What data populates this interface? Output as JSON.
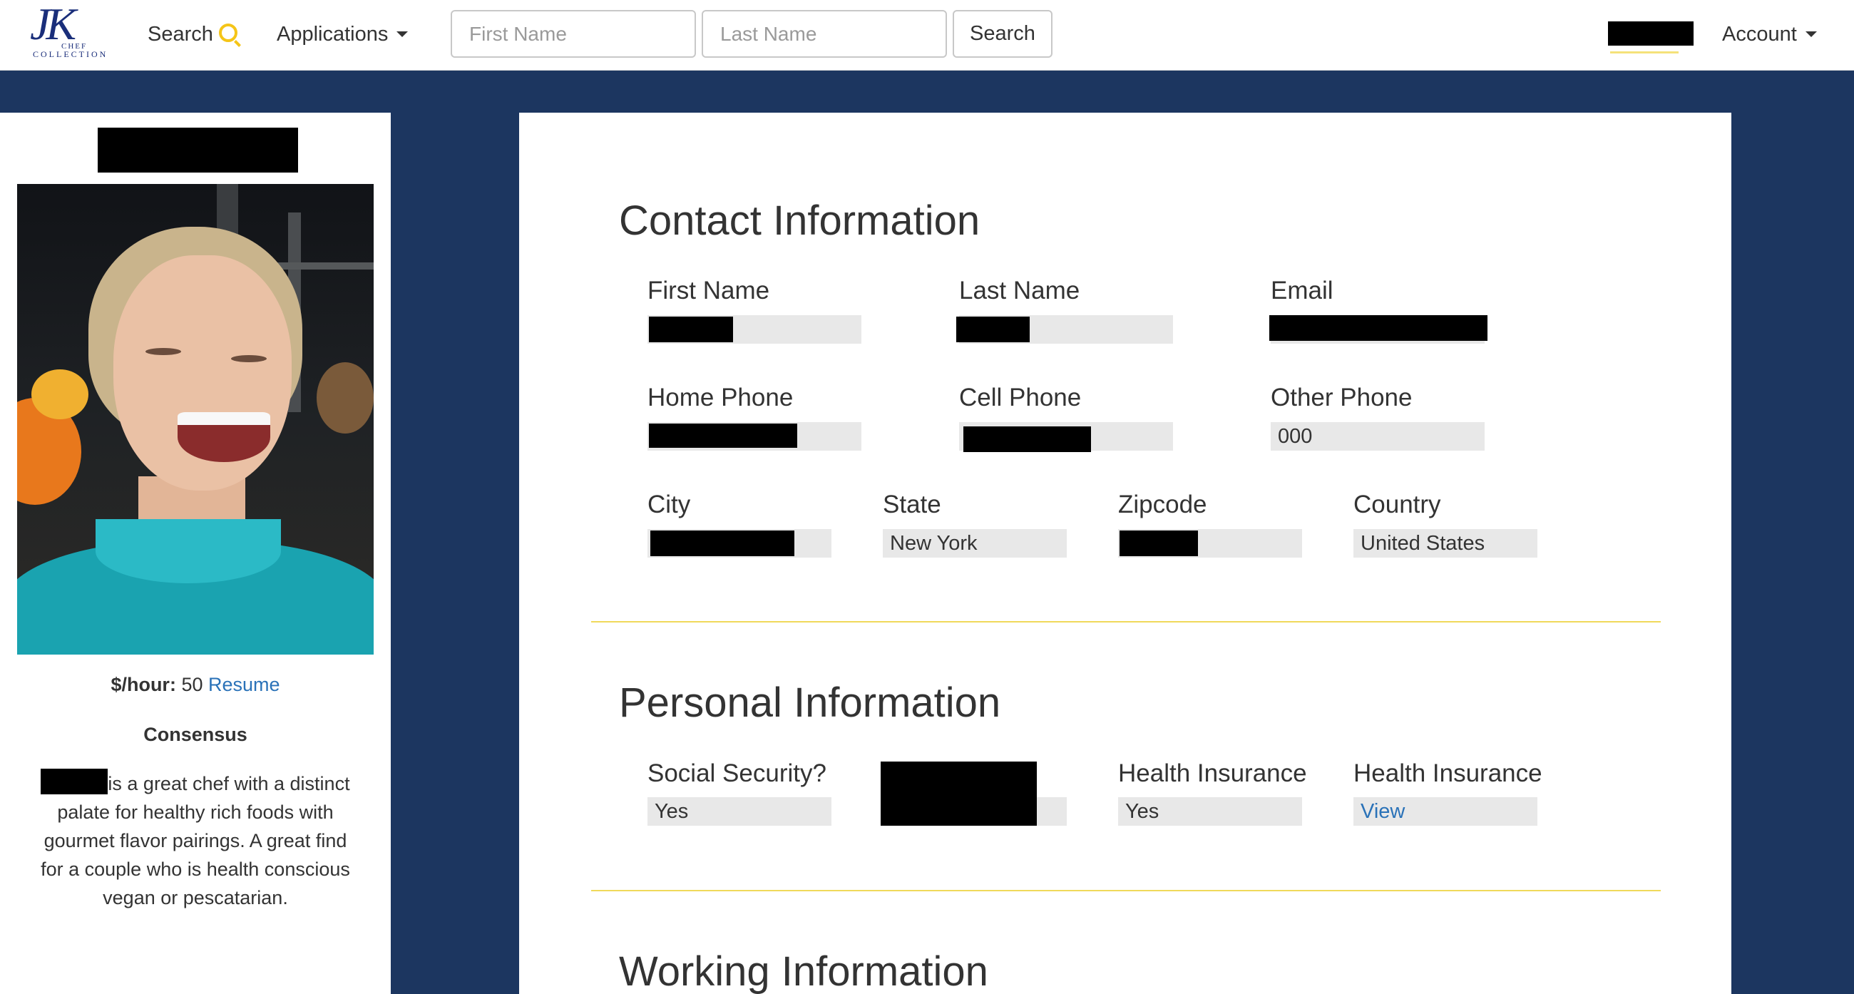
{
  "navbar": {
    "logo_text": "JK",
    "logo_sub": "COLLECTION",
    "logo_sub2": "CHEF",
    "search_link": "Search",
    "applications_link": "Applications",
    "first_name_placeholder": "First Name",
    "last_name_placeholder": "Last Name",
    "search_button": "Search",
    "account_link": "Account"
  },
  "sidebar": {
    "rate_label": "$/hour:",
    "rate_value": "50",
    "resume_link": "Resume",
    "consensus_title": "Consensus",
    "consensus_text": "is a great chef with a distinct palate for healthy rich foods with gourmet flavor pairings. A great find for a couple who is health conscious vegan or pescatarian."
  },
  "contact": {
    "title": "Contact Information",
    "first_name_label": "First Name",
    "last_name_label": "Last Name",
    "email_label": "Email",
    "home_phone_label": "Home Phone",
    "cell_phone_label": "Cell Phone",
    "other_phone_label": "Other Phone",
    "other_phone_value": "000",
    "city_label": "City",
    "state_label": "State",
    "state_value": "New York",
    "zipcode_label": "Zipcode",
    "country_label": "Country",
    "country_value": "United States"
  },
  "personal": {
    "title": "Personal Information",
    "ssn_label": "Social Security?",
    "ssn_value": "Yes",
    "health_insurance_label": "Health Insurance",
    "health_insurance_value": "Yes",
    "health_insurance2_label": "Health Insurance",
    "health_insurance2_link": "View"
  },
  "working": {
    "title": "Working Information"
  },
  "colors": {
    "brand_navy": "#1c3660",
    "accent_yellow": "#f5c518",
    "link_blue": "#2a72b8"
  }
}
